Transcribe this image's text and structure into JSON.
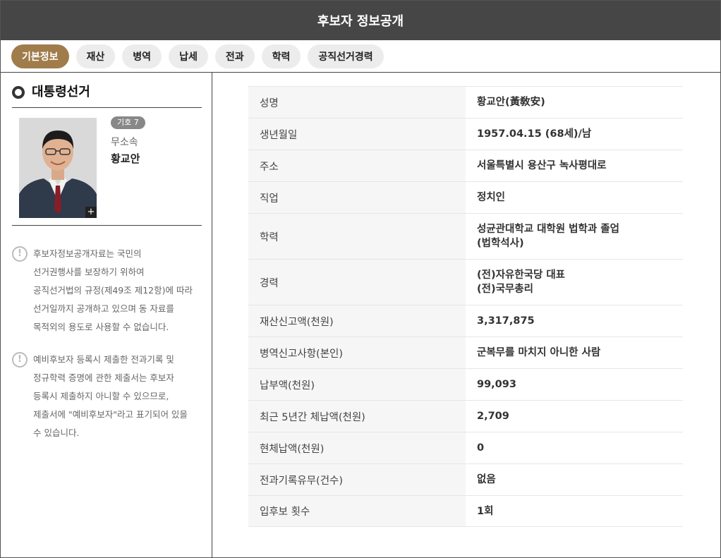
{
  "header": {
    "title": "후보자 정보공개"
  },
  "tabs": [
    {
      "label": "기본정보",
      "active": true
    },
    {
      "label": "재산",
      "active": false
    },
    {
      "label": "병역",
      "active": false
    },
    {
      "label": "납세",
      "active": false
    },
    {
      "label": "전과",
      "active": false
    },
    {
      "label": "학력",
      "active": false
    },
    {
      "label": "공직선거경력",
      "active": false
    }
  ],
  "sidebar": {
    "section_title": "대통령선거",
    "candidate": {
      "badge": "기호 7",
      "party": "무소속",
      "name": "황교안",
      "photo_action": "+"
    },
    "notes": [
      {
        "lines": [
          "후보자정보공개자료는 국민의",
          "선거권행사를 보장하기 위하여",
          "공직선거법의 규정(제49조 제12항)에 따라",
          "선거일까지 공개하고 있으며 동 자료를",
          "목적외의 용도로 사용할 수 없습니다."
        ]
      },
      {
        "lines": [
          "예비후보자 등록시 제출한 전과기록 및",
          "정규학력 증명에 관한 제출서는 후보자",
          "등록시 제출하지 아니할 수 있으므로,",
          "제출서에 \"예비후보자\"라고 표기되어 있을",
          "수 있습니다."
        ]
      }
    ],
    "note_icon": "!"
  },
  "info_table": [
    {
      "label": "성명",
      "values": [
        "황교안(黃敎安)"
      ]
    },
    {
      "label": "생년월일",
      "values": [
        "1957.04.15 (68세)/남"
      ]
    },
    {
      "label": "주소",
      "values": [
        "서울특별시 용산구 녹사평대로"
      ]
    },
    {
      "label": "직업",
      "values": [
        "정치인"
      ]
    },
    {
      "label": "학력",
      "values": [
        "성균관대학교 대학원 법학과 졸업",
        "(법학석사)"
      ]
    },
    {
      "label": "경력",
      "values": [
        "(전)자유한국당 대표",
        "(전)국무총리"
      ]
    },
    {
      "label": "재산신고액(천원)",
      "values": [
        "3,317,875"
      ]
    },
    {
      "label": "병역신고사항(본인)",
      "values": [
        "군복무를 마치지 아니한 사람"
      ]
    },
    {
      "label": "납부액(천원)",
      "values": [
        "99,093"
      ]
    },
    {
      "label": "최근 5년간 체납액(천원)",
      "values": [
        "2,709"
      ]
    },
    {
      "label": "현체납액(천원)",
      "values": [
        "0"
      ]
    },
    {
      "label": "전과기록유무(건수)",
      "values": [
        "없음"
      ]
    },
    {
      "label": "입후보 횟수",
      "values": [
        "1회"
      ]
    }
  ],
  "colors": {
    "header_bg": "#464646",
    "active_tab": "#a07c4a",
    "tab_bg": "#ececec",
    "label_bg": "#f6f6f6"
  }
}
